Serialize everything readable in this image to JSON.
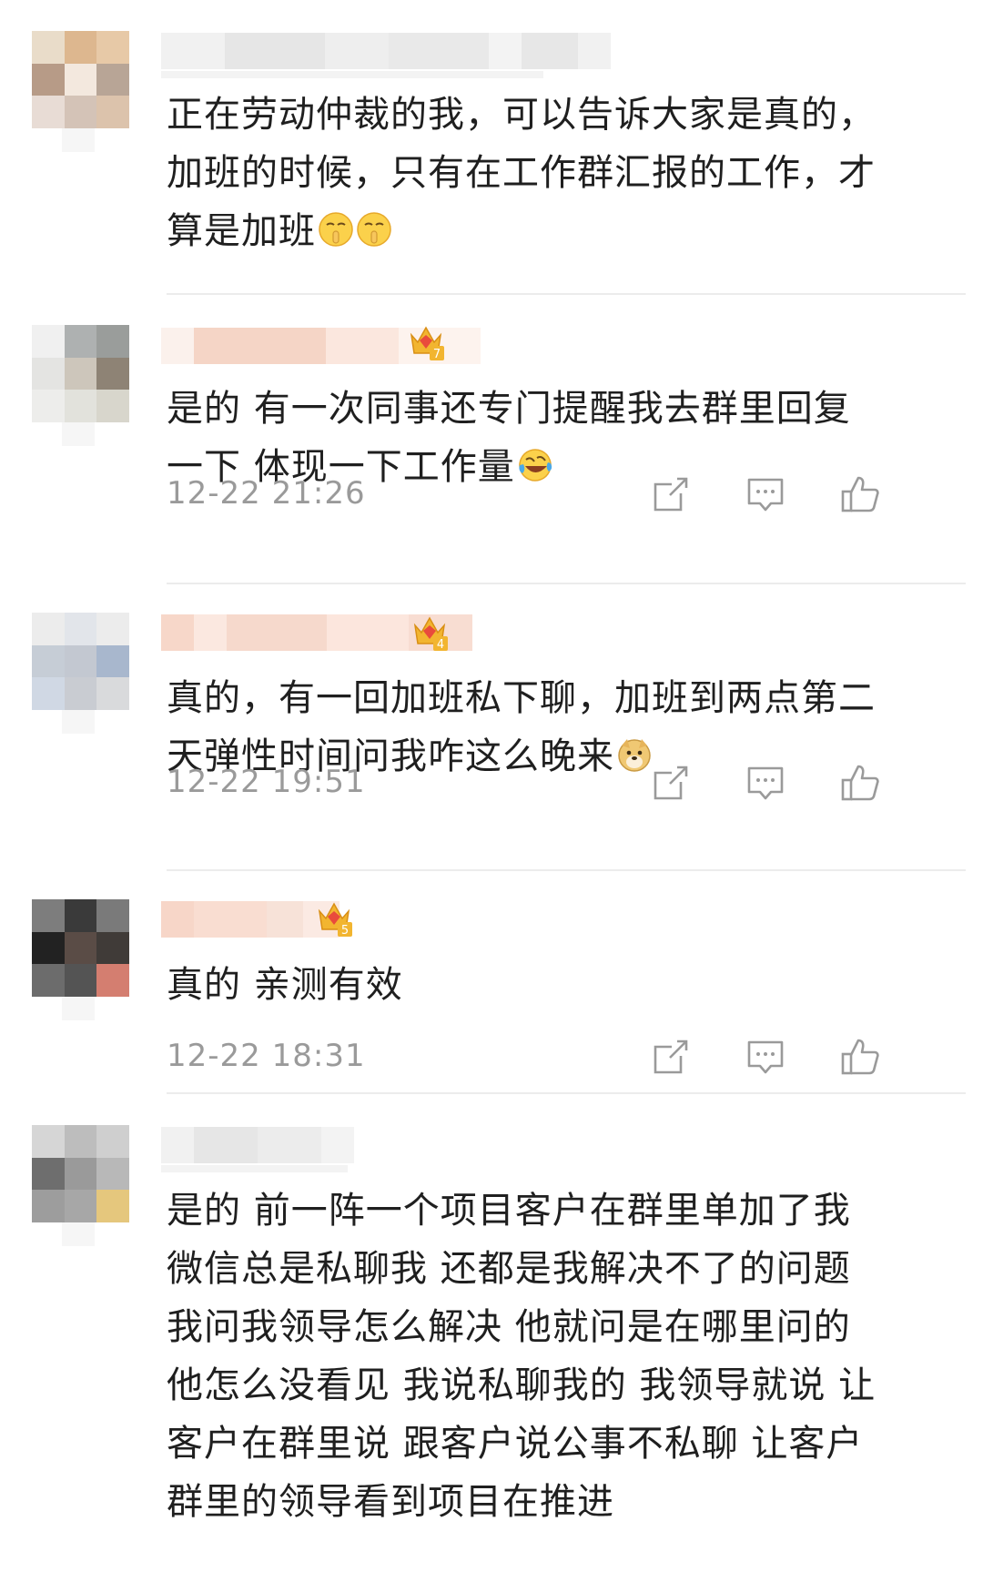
{
  "comments": [
    {
      "lines": [
        "正在劳动仲裁的我，可以告诉大家是真的，",
        "加班的时候，只有在工作群汇报的工作，才",
        "算是加班"
      ],
      "emoji": [
        "shushing-face",
        "shushing-face"
      ],
      "timestamp": null,
      "crown_level": null
    },
    {
      "lines": [
        "是的 有一次同事还专门提醒我去群里回复",
        "一下 体现一下工作量"
      ],
      "emoji": [
        "laughing-tears-face"
      ],
      "timestamp": "12-22 21:26",
      "crown_level": "7"
    },
    {
      "lines": [
        "真的，有一回加班私下聊，加班到两点第二",
        "天弹性时间问我咋这么晚来"
      ],
      "emoji": [
        "doge-face"
      ],
      "timestamp": "12-22 19:51",
      "crown_level": "4"
    },
    {
      "lines": [
        "真的 亲测有效"
      ],
      "emoji": [],
      "timestamp": "12-22 18:31",
      "crown_level": "5"
    },
    {
      "lines": [
        "是的 前一阵一个项目客户在群里单加了我",
        "微信总是私聊我 还都是我解决不了的问题",
        "我问我领导怎么解决 他就问是在哪里问的",
        "他怎么没看见 我说私聊我的 我领导就说 让",
        "客户在群里说 跟客户说公事不私聊 让客户",
        "群里的领导看到项目在推进"
      ],
      "emoji": [],
      "timestamp": null,
      "crown_level": null
    }
  ],
  "actions": {
    "icons": [
      "share-icon",
      "reply-icon",
      "like-icon"
    ]
  },
  "colors": {
    "text": "#1f1f1f",
    "timestamp": "#9a9a9a",
    "icon": "#9a9a9a",
    "divider": "#ececec",
    "crown_gold": "#f2b530",
    "crown_red": "#e94b3c"
  }
}
